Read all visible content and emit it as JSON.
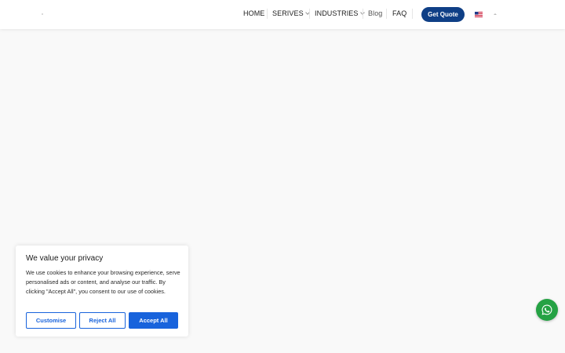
{
  "header": {
    "nav": [
      {
        "label": "HOME",
        "dropdown": false
      },
      {
        "label": "SERIVES",
        "dropdown": true
      },
      {
        "label": "INDUSTRIES",
        "dropdown": true
      },
      {
        "label": "Blog",
        "dropdown": false
      },
      {
        "label": "FAQ",
        "dropdown": false
      }
    ],
    "quote_button": "Get Quote",
    "language_icon": "us-flag-icon",
    "language_toggle_icon": "caret-up-icon"
  },
  "cookie_banner": {
    "title": "We value your privacy",
    "text": "We use cookies to enhance your browsing experience, serve personalised ads or content, and analyse our traffic. By clicking \"Accept All\", you consent to our use of cookies.",
    "buttons": {
      "customise": "Customise",
      "reject": "Reject All",
      "accept": "Accept All"
    },
    "accent_color": "#1863dc"
  },
  "floating": {
    "whatsapp_icon": "whatsapp-icon",
    "whatsapp_color": "#25a244"
  },
  "colors": {
    "brand": "#0f3f86"
  }
}
